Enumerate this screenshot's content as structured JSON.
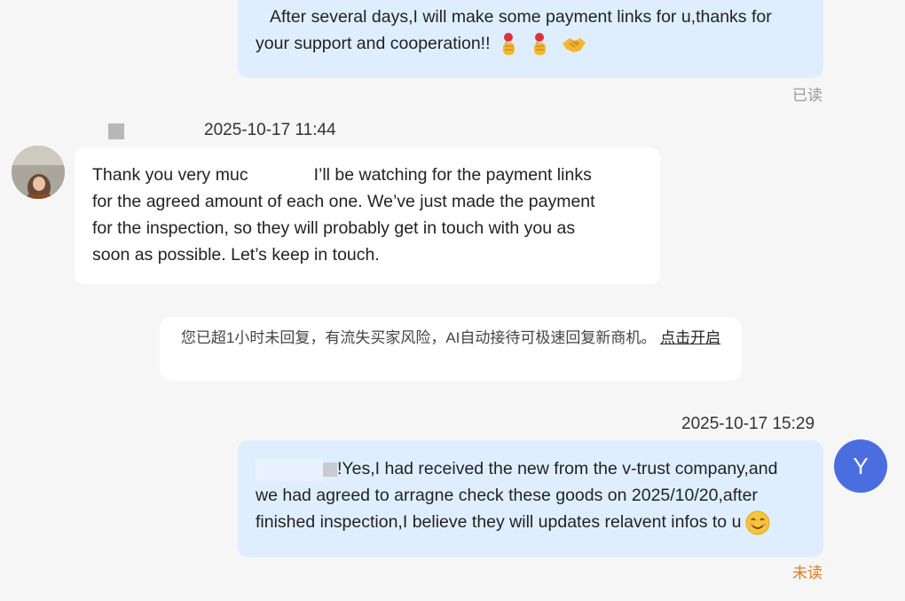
{
  "messages": [
    {
      "direction": "outgoing",
      "lines": [
        "After several days,I will make some payment links for u,thanks for",
        "your support and cooperation!!"
      ],
      "emojis": [
        "rose-thumb-emoji",
        "rose-thumb-emoji",
        "handshake-emoji"
      ],
      "status": "已读"
    },
    {
      "direction": "incoming",
      "timestamp": "2025-10-17 11:44",
      "lines": [
        "Thank you very muc",
        "I’ll be watching for the payment links",
        "for the agreed amount of each one. We’ve just made the payment",
        "for the inspection, so they will probably get in touch with you as",
        "soon as possible. Let’s keep in touch."
      ]
    },
    {
      "direction": "outgoing",
      "timestamp": "2025-10-17 15:29",
      "avatar_letter": "Y",
      "lines": [
        "!Yes,I had received the new from the v-trust company,and",
        "we had agreed to arragne check these goods on 2025/10/20,after",
        "finished inspection,I believe they will updates relavent infos to u"
      ],
      "emojis": [
        "smiling-face-emoji"
      ],
      "status": "未读"
    }
  ],
  "system_notice": {
    "text": "您已超1小时未回复，有流失买家风险，AI自动接待可极速回复新商机。",
    "link": "点击开启"
  },
  "colors": {
    "outgoing_bubble": "#dfeeff",
    "incoming_bubble": "#ffffff",
    "read_status": "#9a9a9a",
    "unread_status": "#e07b1e",
    "avatar_y": "#4a6ee0"
  }
}
